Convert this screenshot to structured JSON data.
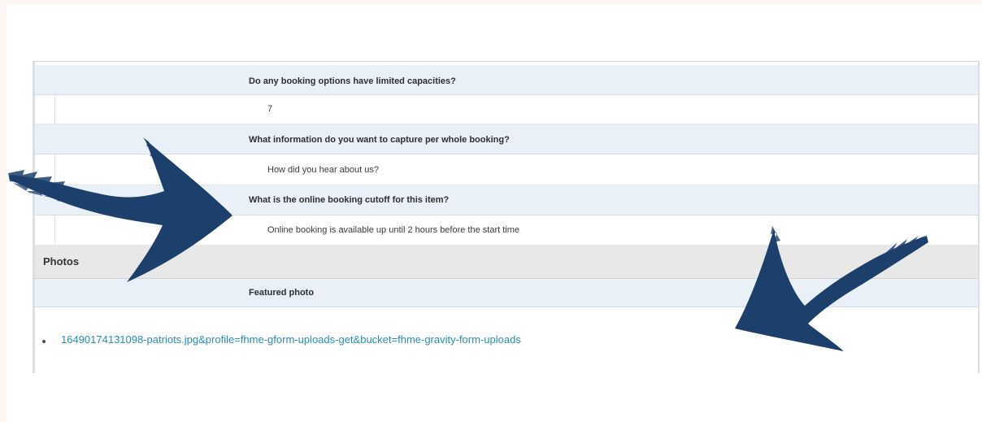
{
  "booking_fields": [
    {
      "question": "Do any booking options have limited capacities?",
      "answer": "7"
    },
    {
      "question": "What information do you want to capture per whole booking?",
      "answer": "How did you hear about us?"
    },
    {
      "question": "What is the online booking cutoff for this item?",
      "answer": "Online booking is available up until 2 hours before the start time"
    }
  ],
  "photos": {
    "section_title": "Photos",
    "featured_label": "Featured photo",
    "file_link": "16490174131098-patriots.jpg&profile=fhme-gform-uploads-get&bucket=fhme-gravity-form-uploads"
  },
  "colors": {
    "arrow": "#1d3f6b",
    "link": "#2a8cb0",
    "question_row_bg": "#e9f0f8",
    "section_row_bg": "#e8e8e8"
  },
  "icons": [
    "left-arrow-annotation-icon",
    "right-arrow-annotation-icon",
    "bullet-icon"
  ]
}
